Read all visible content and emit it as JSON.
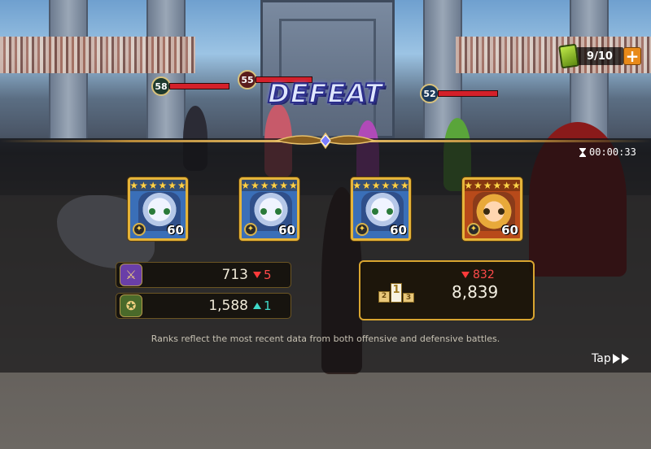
{
  "result": {
    "title": "DEFEAT"
  },
  "energy": {
    "value": "9/10",
    "add_icon": "plus-icon"
  },
  "timer": {
    "icon": "hourglass-icon",
    "value": "00:00:33"
  },
  "enemy_levels": [
    "58",
    "55",
    "52"
  ],
  "heroes": [
    {
      "stars": 6,
      "level": "60",
      "portrait": "mascot-blue"
    },
    {
      "stars": 6,
      "level": "60",
      "portrait": "mascot-blue"
    },
    {
      "stars": 6,
      "level": "60",
      "portrait": "mascot-blue"
    },
    {
      "stars": 6,
      "level": "60",
      "portrait": "blond-warrior"
    }
  ],
  "stats": {
    "attack": {
      "icon": "crossed-swords-icon",
      "value": "713",
      "delta": "5",
      "direction": "down"
    },
    "medal": {
      "icon": "medal-icon",
      "value": "1,588",
      "delta": "1",
      "direction": "up"
    }
  },
  "rank": {
    "icon": "podium-icon",
    "podium_first": "1",
    "podium_second": "2",
    "podium_third": "3",
    "change": "832",
    "value": "8,839"
  },
  "notice": "Ranks reflect the most recent data from both offensive and defensive battles.",
  "tap": {
    "label": "Tap"
  },
  "colors": {
    "accent_gold": "#d9a530",
    "loss_red": "#ff4a4a",
    "gain_teal": "#3fd9c8"
  }
}
